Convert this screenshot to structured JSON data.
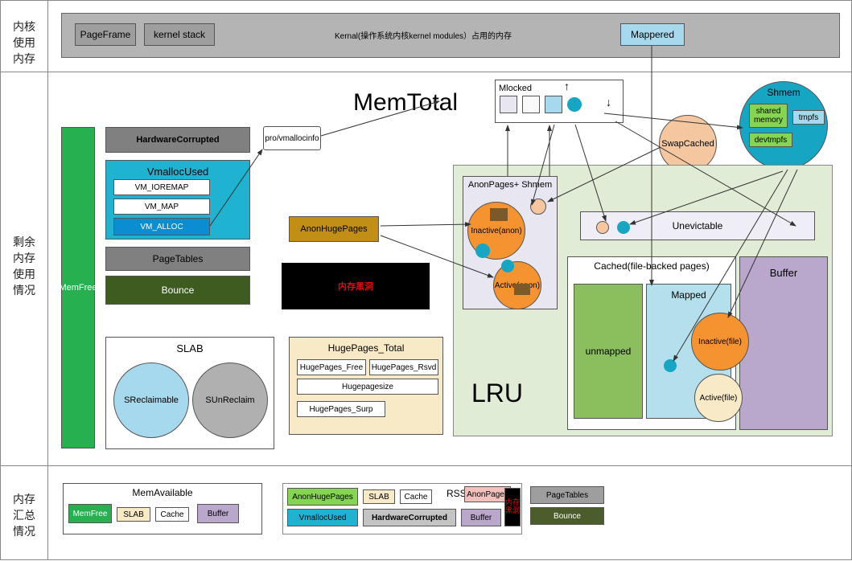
{
  "sections": {
    "kernel_memory": "内核\n使用\n内存",
    "remaining_memory": "剩余\n内存\n使用\n情况",
    "summary": "内存\n汇总\n情况"
  },
  "header": {
    "page_frame": "PageFrame",
    "kernel_stack": "kernel stack",
    "kernel_text": "Kernal(操作系统内核kernel modules）占用的内存",
    "mappered": "Mappered"
  },
  "mem_total": "MemTotal",
  "mem_free": "MemFree",
  "hardware_corrupted": "HardwareCorrupted",
  "vmalloc": {
    "title": "VmallocUsed",
    "ioremap": "VM_IOREMAP",
    "map": "VM_MAP",
    "alloc": "VM_ALLOC"
  },
  "page_tables": "PageTables",
  "bounce": "Bounce",
  "pro_vmallocinfo": "pro/vmallocinfo",
  "anon_huge_pages": "AnonHugePages",
  "black_hole": "内存黑洞",
  "slab": {
    "title": "SLAB",
    "sreclaimable": "SReclaimable",
    "sunreclaim": "SUnReclaim"
  },
  "hugepages": {
    "title": "HugePages_Total",
    "free": "HugePages_Free",
    "rsvd": "HugePages_Rsvd",
    "size": "Hugepagesize",
    "surp": "HugePages_Surp"
  },
  "mlocked": "Mlocked",
  "swap_cached": "SwapCached",
  "shmem": {
    "title": "Shmem",
    "shared_memory": "shared\nmemory",
    "tmpfs": "tmpfs",
    "devtmpfs": "devtmpfs"
  },
  "lru": "LRU",
  "anon_pages_shmem": "AnonPages+\nShmem",
  "inactive_anon": "Inactive(anon)",
  "active_anon": "Active(anon)",
  "unevictable": "Unevictable",
  "cached_title": "Cached(file-backed pages)",
  "unmapped": "unmapped",
  "mapped": "Mapped",
  "buffer": "Buffer",
  "inactive_file": "Inactive(file)",
  "active_file": "Active(file)",
  "summary": {
    "mem_available": "MemAvailable",
    "mem_free": "MemFree",
    "slab": "SLAB",
    "cache": "Cache",
    "buffer": "Buffer",
    "rss": "RSS",
    "anon_huge_pages": "AnonHugePages",
    "slab2": "SLAB",
    "cache2": "Cache",
    "vmalloc_used": "VmallocUsed",
    "hardware_corrupted": "HardwareCorrupted",
    "buffer2": "Buffer",
    "anon_pages": "AnonPages",
    "black_hole": "内存\n黑洞",
    "page_tables": "PageTables",
    "bounce": "Bounce"
  },
  "colors": {
    "gray_bg": "#b4b4b4",
    "gray_box": "#9e9e9e",
    "light_blue": "#a6d9ed",
    "green": "#26b050",
    "dark_gray": "#808080",
    "cyan": "#1fb3d1",
    "blue_alloc": "#0a8ed1",
    "olive": "#3e5b20",
    "orange_brown": "#c28f16",
    "black": "#000000",
    "red": "#e20a0a",
    "cream": "#f8e9c7",
    "lavender": "#e8e6f0",
    "peach": "#f5c7a0",
    "teal_circle": "#16a6c4",
    "orange": "#f59331",
    "light_green": "#e0ecd5",
    "green_box": "#8bbf5e",
    "purple": "#b9a7cc",
    "light_cyan": "#b3e0ec",
    "light_lavender": "#efedf5",
    "yellow_green": "#86d552",
    "dark_olive": "#4a5d2a",
    "pink": "#f2c1be"
  }
}
